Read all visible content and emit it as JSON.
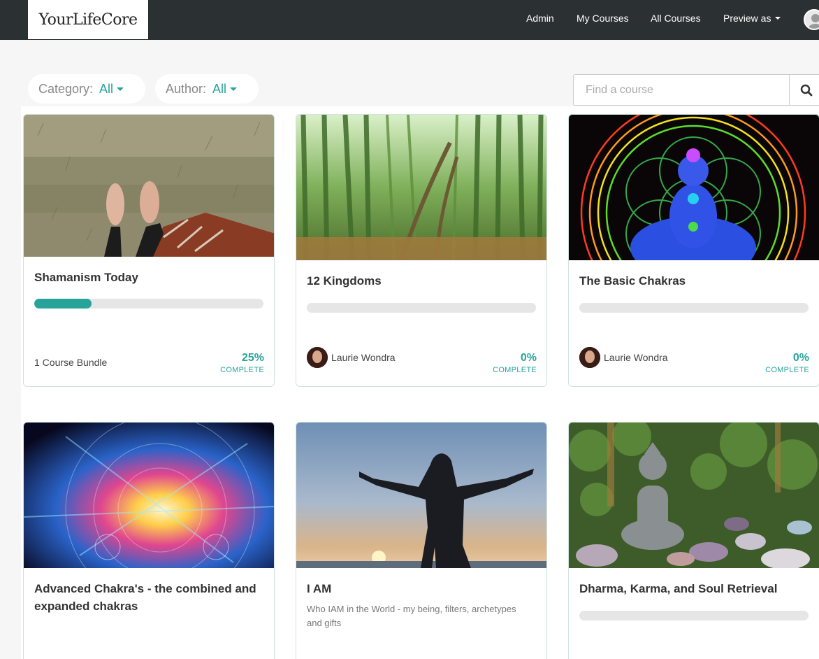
{
  "brand": {
    "logo_text": "YourLifeCore"
  },
  "nav": {
    "admin": "Admin",
    "my_courses": "My Courses",
    "all_courses": "All Courses",
    "preview_as": "Preview as"
  },
  "filters": {
    "category_label": "Category:",
    "category_value": "All",
    "author_label": "Author:",
    "author_value": "All"
  },
  "search": {
    "placeholder": "Find a course"
  },
  "courses": [
    {
      "title": "Shamanism Today",
      "footer": "1 Course Bundle",
      "percent": "25%",
      "progress": 0.25,
      "complete_label": "COMPLETE",
      "image": "bare feet on grass"
    },
    {
      "title": "12 Kingdoms",
      "author": "Laurie Wondra",
      "percent": "0%",
      "progress": 0,
      "complete_label": "COMPLETE",
      "image": "bamboo forest"
    },
    {
      "title": "The Basic Chakras",
      "author": "Laurie Wondra",
      "percent": "0%",
      "progress": 0,
      "complete_label": "COMPLETE",
      "image": "meditating figure in flower of life"
    },
    {
      "title": "Advanced Chakra's - the combined and expanded chakras",
      "image": "cosmic energy burst"
    },
    {
      "title": "I AM",
      "subtitle": "Who IAM in the World - my being, filters, archetypes and gifts",
      "image": "silhouette with open arms at sunset"
    },
    {
      "title": "Dharma, Karma, and Soul Retrieval",
      "progress": 0,
      "image": "stone buddha in garden"
    }
  ],
  "colors": {
    "accent": "#27a39a",
    "nav_bg": "#2b3033",
    "progress_track": "#e6e6e6"
  }
}
